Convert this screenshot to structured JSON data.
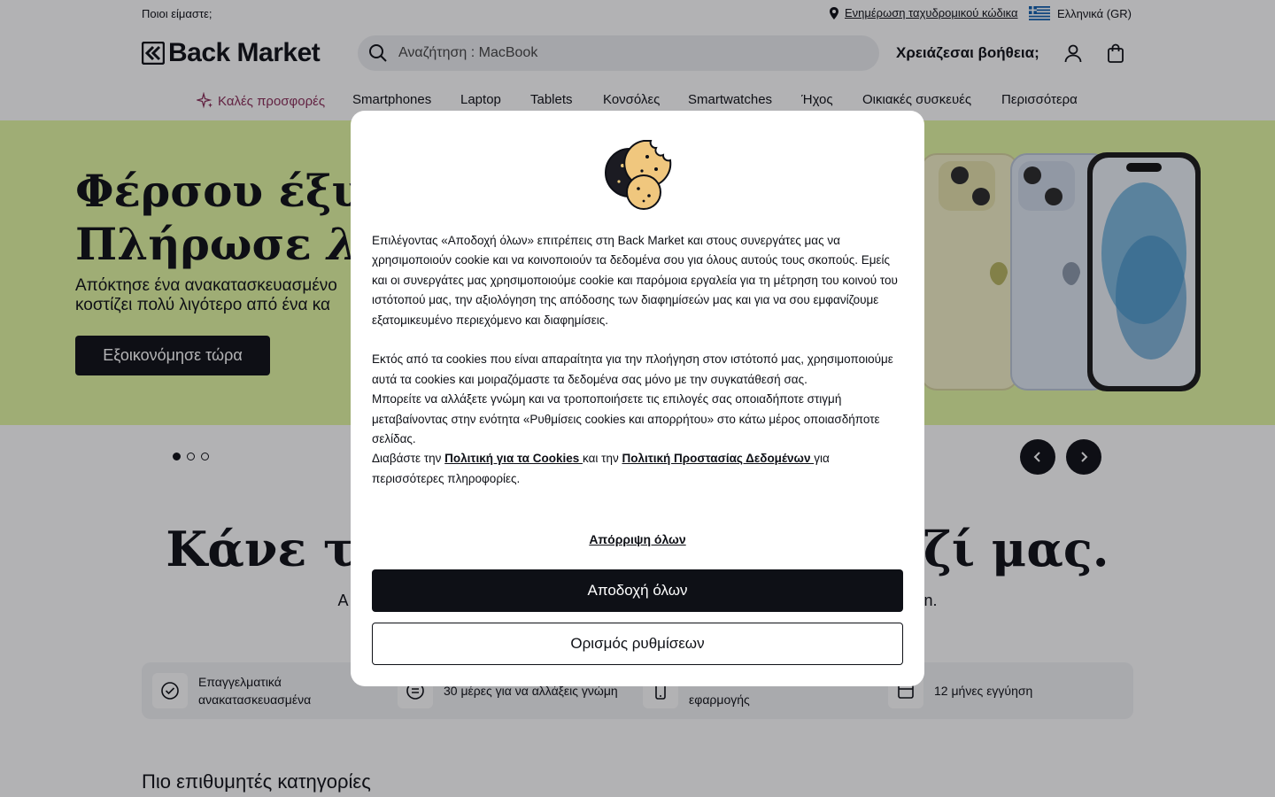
{
  "topbar": {
    "about": "Ποιοι είμαστε;",
    "postal_code": "Ενημέρωση ταχυδρομικού κώδικα",
    "language": "Ελληνικά (GR)"
  },
  "header": {
    "logo_text": "Back Market",
    "search_placeholder": "Αναζήτηση : MacBook",
    "help": "Χρειάζεσαι βοήθεια;"
  },
  "nav": {
    "items": [
      "Καλές προσφορές",
      "Smartphones",
      "Laptop",
      "Tablets",
      "Κονσόλες",
      "Smartwatches",
      "Ήχος",
      "Οικιακές συσκευές",
      "Περισσότερα"
    ]
  },
  "hero": {
    "title_line1": "Φέρσου έξυπν",
    "title_line2_a": "Πλήρωσε ",
    "title_line2_b": "λιγό",
    "subtitle_line1": "Απόκτησε ένα ανακατασκευασμένο",
    "subtitle_line2": "κοστίζει πολύ λιγότερο από ένα κα",
    "cta": "Εξοικονόμησε τώρα"
  },
  "carousel": {
    "slides": 3,
    "active": 1
  },
  "section": {
    "title_left": "Κάνε τ",
    "title_right": "αζί μας.",
    "subtitle_left": "A",
    "subtitle_right": "n."
  },
  "features": [
    {
      "line1": "Επαγγελματικά",
      "line2": "ανακατασκευασμένα",
      "icon": "badge-check-icon"
    },
    {
      "line1": "30 μέρες για να αλλάξεις γνώμη",
      "line2": "",
      "icon": "refund-icon"
    },
    {
      "line1": "",
      "line2": "εφαρμογής",
      "icon": "phone-icon"
    },
    {
      "line1": "12 μήνες εγγύηση",
      "line2": "",
      "icon": "calendar-icon"
    }
  ],
  "categories_title": "Πιο επιθυμητές κατηγορίες",
  "modal": {
    "p1": "Επιλέγοντας «Αποδοχή όλων» επιτρέπεις στη Back Market και στους συνεργάτες μας να χρησιμοποιούν cookie και να κοινοποιούν τα δεδομένα σου για όλους αυτούς τους σκοπούς. Εμείς και οι συνεργάτες μας χρησιμοποιούμε cookie και παρόμοια εργαλεία για τη μέτρηση του κοινού του ιστότοπού μας, την αξιολόγηση της απόδοσης των διαφημίσεών μας και για να σου εμφανίζουμε εξατομικευμένο περιεχόμενο και διαφημίσεις.",
    "p2": "Εκτός από τα cookies που είναι απαραίτητα για την πλοήγηση στον ιστότοπό μας, χρησιμοποιούμε αυτά τα cookies και μοιραζόμαστε τα δεδομένα σας μόνο με την συγκατάθεσή σας.",
    "p3": "Μπορείτε να αλλάξετε γνώμη και να τροποποιήσετε τις επιλογές σας οποιαδήποτε στιγμή μεταβαίνοντας στην ενότητα «Ρυθμίσεις cookies και απορρήτου» στο κάτω μέρος οποιασδήποτε σελίδας.",
    "p4_pre": "Διαβάστε την ",
    "cookie_policy_link": "Πολιτική για τα Cookies ",
    "p4_mid": "και την ",
    "privacy_policy_link": "Πολιτική Προστασίας Δεδομένων ",
    "p4_post": "για περισσότερες πληροφορίες.",
    "reject_all": "Απόρριψη όλων",
    "accept_all": "Αποδοχή όλων",
    "settings": "Ορισμός ρυθμίσεων"
  },
  "colors": {
    "ink": "#0e1016",
    "hero_bg": "#e3f8a2",
    "deals": "#8a2c57",
    "search_bg": "#eceef1"
  }
}
